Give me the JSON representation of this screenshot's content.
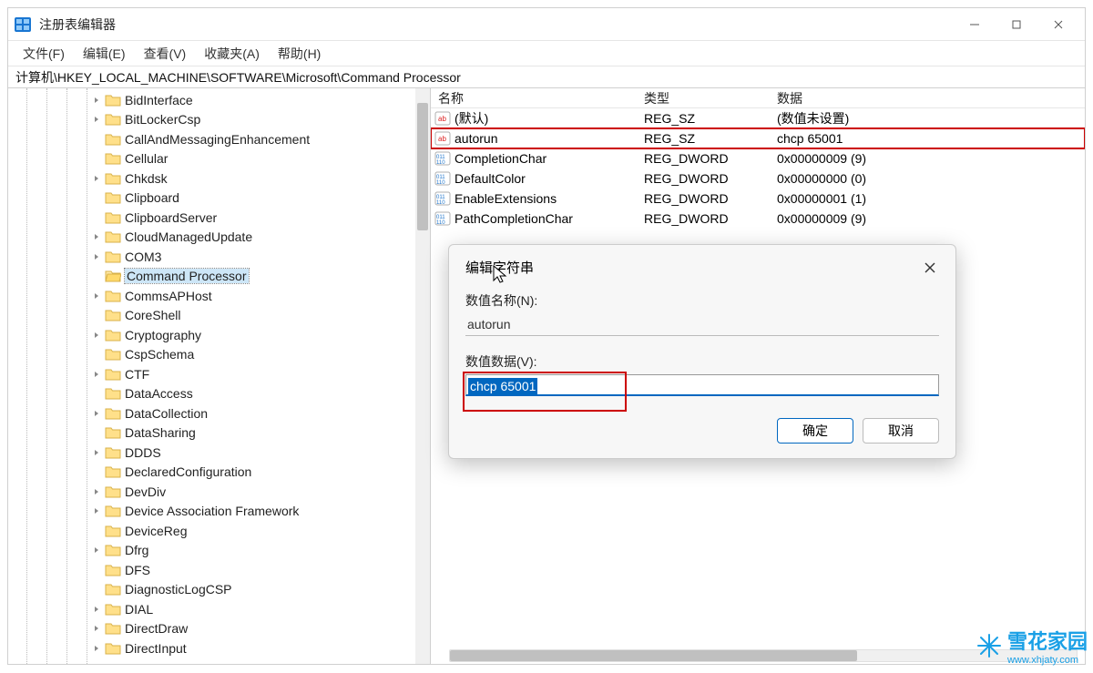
{
  "window": {
    "title": "注册表编辑器"
  },
  "menubar": [
    "文件(F)",
    "编辑(E)",
    "查看(V)",
    "收藏夹(A)",
    "帮助(H)"
  ],
  "address": "计算机\\HKEY_LOCAL_MACHINE\\SOFTWARE\\Microsoft\\Command Processor",
  "tree": [
    {
      "label": "BidInterface",
      "expand": true
    },
    {
      "label": "BitLockerCsp",
      "expand": true
    },
    {
      "label": "CallAndMessagingEnhancement",
      "expand": false
    },
    {
      "label": "Cellular",
      "expand": false
    },
    {
      "label": "Chkdsk",
      "expand": true
    },
    {
      "label": "Clipboard",
      "expand": false
    },
    {
      "label": "ClipboardServer",
      "expand": false
    },
    {
      "label": "CloudManagedUpdate",
      "expand": true
    },
    {
      "label": "COM3",
      "expand": true
    },
    {
      "label": "Command Processor",
      "expand": false,
      "open": true,
      "selected": true
    },
    {
      "label": "CommsAPHost",
      "expand": true
    },
    {
      "label": "CoreShell",
      "expand": false
    },
    {
      "label": "Cryptography",
      "expand": true
    },
    {
      "label": "CspSchema",
      "expand": false
    },
    {
      "label": "CTF",
      "expand": true
    },
    {
      "label": "DataAccess",
      "expand": false
    },
    {
      "label": "DataCollection",
      "expand": true
    },
    {
      "label": "DataSharing",
      "expand": false
    },
    {
      "label": "DDDS",
      "expand": true
    },
    {
      "label": "DeclaredConfiguration",
      "expand": false
    },
    {
      "label": "DevDiv",
      "expand": true
    },
    {
      "label": "Device Association Framework",
      "expand": true
    },
    {
      "label": "DeviceReg",
      "expand": false
    },
    {
      "label": "Dfrg",
      "expand": true
    },
    {
      "label": "DFS",
      "expand": false
    },
    {
      "label": "DiagnosticLogCSP",
      "expand": false
    },
    {
      "label": "DIAL",
      "expand": true
    },
    {
      "label": "DirectDraw",
      "expand": true
    },
    {
      "label": "DirectInput",
      "expand": true
    }
  ],
  "list": {
    "columns": {
      "name": "名称",
      "type": "类型",
      "data": "数据"
    },
    "rows": [
      {
        "icon": "sz",
        "name": "(默认)",
        "type": "REG_SZ",
        "data": "(数值未设置)"
      },
      {
        "icon": "sz",
        "name": "autorun",
        "type": "REG_SZ",
        "data": "chcp 65001",
        "highlight": true
      },
      {
        "icon": "dw",
        "name": "CompletionChar",
        "type": "REG_DWORD",
        "data": "0x00000009 (9)"
      },
      {
        "icon": "dw",
        "name": "DefaultColor",
        "type": "REG_DWORD",
        "data": "0x00000000 (0)"
      },
      {
        "icon": "dw",
        "name": "EnableExtensions",
        "type": "REG_DWORD",
        "data": "0x00000001 (1)"
      },
      {
        "icon": "dw",
        "name": "PathCompletionChar",
        "type": "REG_DWORD",
        "data": "0x00000009 (9)"
      }
    ]
  },
  "dialog": {
    "title": "编辑字符串",
    "name_label": "数值名称(N):",
    "name_value": "autorun",
    "data_label": "数值数据(V):",
    "data_value": "chcp 65001",
    "ok": "确定",
    "cancel": "取消"
  },
  "watermark": {
    "name": "雪花家园",
    "url": "www.xhjaty.com"
  }
}
